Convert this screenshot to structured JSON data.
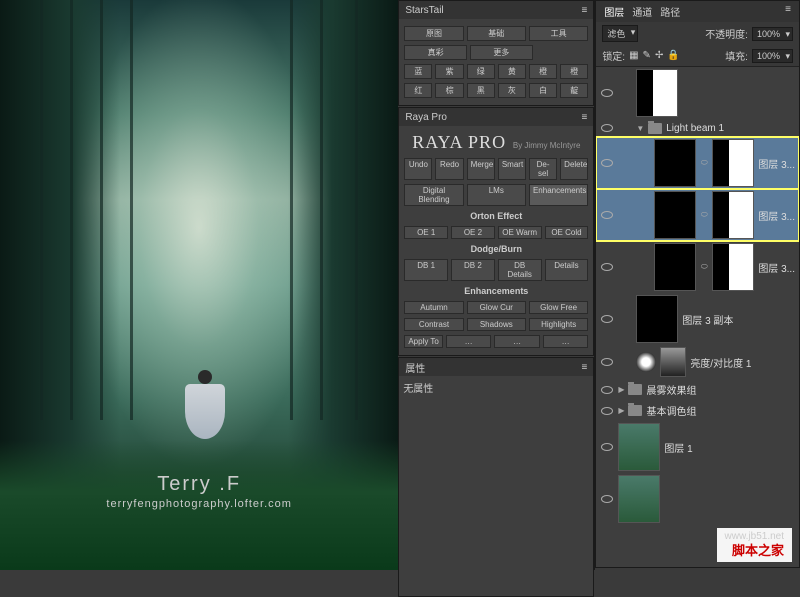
{
  "canvas": {
    "artist_name": "Terry .F",
    "artist_url": "terryfengphotography.lofter.com"
  },
  "starstail": {
    "title": "StarsTail",
    "row1": [
      "原图",
      "基础",
      "工具"
    ],
    "row2": [
      "真彩",
      "更多"
    ],
    "grid": [
      "蓝",
      "紫",
      "绿",
      "黄",
      "橙",
      "橙",
      "红",
      "棕",
      "黑",
      "灰",
      "白",
      "靛"
    ]
  },
  "raya": {
    "title": "Raya Pro",
    "brand": "RAYA PRO",
    "byline": "By Jimmy McIntyre",
    "actions": [
      "Undo",
      "Redo",
      "Merge",
      "Smart",
      "De-sel",
      "Delete"
    ],
    "tabs": [
      "Digital Blending",
      "LMs",
      "Enhancements"
    ],
    "orton_label": "Orton Effect",
    "orton": [
      "OE 1",
      "OE 2",
      "OE Warm",
      "OE Cold"
    ],
    "dodge_label": "Dodge/Burn",
    "dodge": [
      "DB 1",
      "DB 2",
      "DB Details",
      "Details"
    ],
    "enh_label": "Enhancements",
    "enh1": [
      "Autumn",
      "Glow Cur",
      "Glow Free"
    ],
    "enh2": [
      "Contrast",
      "Shadows",
      "Highlights"
    ],
    "apply": "Apply To",
    "apply_opts": [
      "…",
      "…",
      "…"
    ]
  },
  "props": {
    "title": "属性",
    "empty": "无属性"
  },
  "layers": {
    "tabs": [
      "图层",
      "通道",
      "路径"
    ],
    "mode_label": "",
    "mode": "滤色",
    "opacity_label": "不透明度:",
    "opacity": "100%",
    "lock_label": "锁定:",
    "fill_label": "填充:",
    "fill": "100%",
    "items": [
      {
        "type": "mask-layer",
        "name": "",
        "indent": 1
      },
      {
        "type": "group-open",
        "name": "Light beam 1",
        "indent": 1
      },
      {
        "type": "layer-sel",
        "name": "图层 3...",
        "indent": 2
      },
      {
        "type": "layer-sel",
        "name": "图层 3...",
        "indent": 2
      },
      {
        "type": "layer",
        "name": "图层 3...",
        "indent": 2
      },
      {
        "type": "layer-copy",
        "name": "图层 3 副本",
        "indent": 1
      },
      {
        "type": "adjustment",
        "name": "亮度/对比度 1",
        "indent": 1
      },
      {
        "type": "group",
        "name": "晨雾效果组",
        "indent": 0
      },
      {
        "type": "group",
        "name": "基本调色组",
        "indent": 0
      },
      {
        "type": "image",
        "name": "图层 1",
        "indent": 0
      },
      {
        "type": "image",
        "name": "",
        "indent": 0
      }
    ]
  },
  "watermark": {
    "url": "www.jb51.net",
    "name": "脚本之家"
  }
}
